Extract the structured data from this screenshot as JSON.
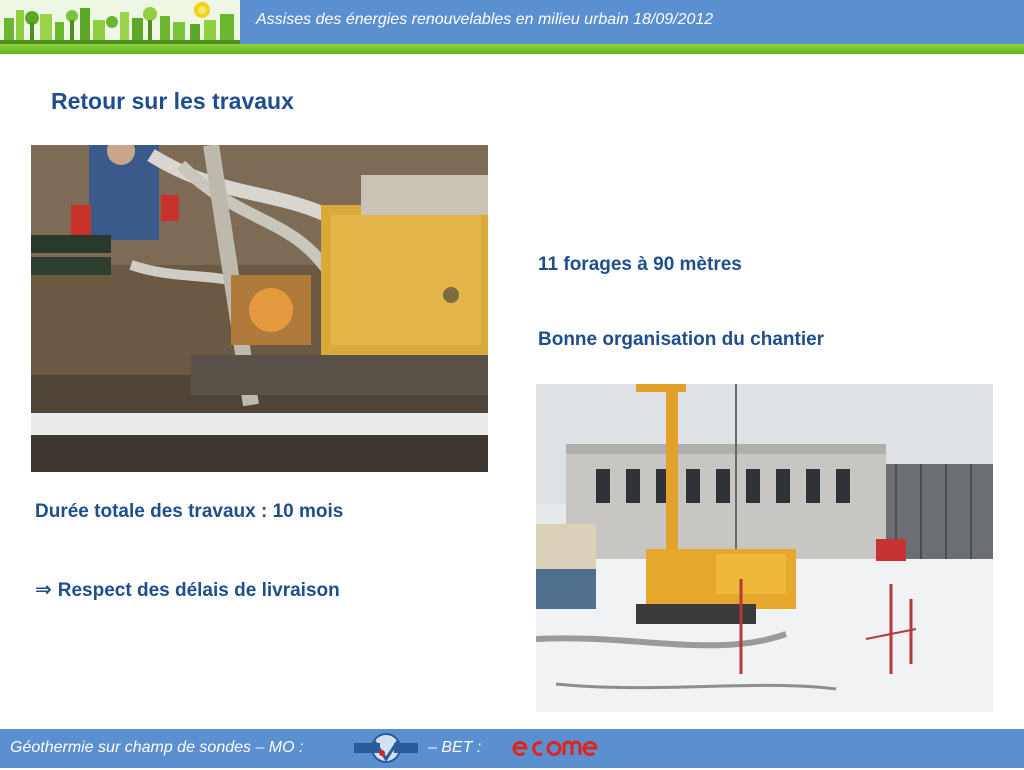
{
  "header": {
    "title": "Assises des énergies renouvelables en milieu urbain 18/09/2012"
  },
  "slide": {
    "title": "Retour sur les travaux",
    "right_texts": [
      "11 forages à 90 mètres",
      "Bonne organisation du chantier"
    ],
    "left_texts": {
      "duration": "Durée totale des travaux : 10 mois",
      "respect": "Respect des délais de livraison"
    },
    "arrow_icon": "double-arrow-right-icon"
  },
  "footer": {
    "text_mo": "Géothermie sur champ de sondes  –  MO :",
    "sies_logo": "SIES VYZZ",
    "text_bet": "–   BET :",
    "bet_logo": "ecome"
  },
  "colors": {
    "header_blue": "#5a8fd0",
    "accent_green": "#7cc62d",
    "title_blue": "#1f4e8c",
    "ecome_red": "#e2231a"
  }
}
